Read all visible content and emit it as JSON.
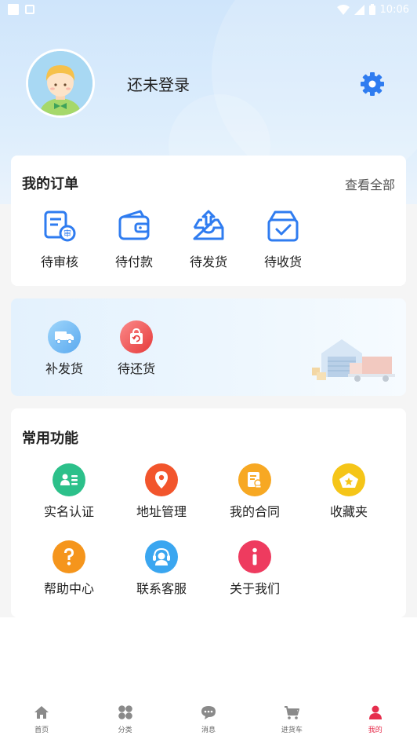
{
  "status_bar": {
    "time": "10:06"
  },
  "profile": {
    "login_text": "还未登录"
  },
  "orders": {
    "title": "我的订单",
    "view_all": "查看全部",
    "items": [
      {
        "label": "待审核",
        "icon": "pending-review-icon"
      },
      {
        "label": "待付款",
        "icon": "wallet-icon"
      },
      {
        "label": "待发货",
        "icon": "outbox-icon"
      },
      {
        "label": "待收货",
        "icon": "receive-box-icon"
      }
    ]
  },
  "promo": {
    "items": [
      {
        "label": "补发货",
        "icon": "truck-icon"
      },
      {
        "label": "待还货",
        "icon": "return-bag-icon"
      }
    ]
  },
  "features": {
    "title": "常用功能",
    "items": [
      {
        "label": "实名认证",
        "icon": "id-card-icon",
        "color": "#2cc08a"
      },
      {
        "label": "地址管理",
        "icon": "location-pin-icon",
        "color": "#f2552c"
      },
      {
        "label": "我的合同",
        "icon": "contract-icon",
        "color": "#f7a823"
      },
      {
        "label": "收藏夹",
        "icon": "star-icon",
        "color": "#f5c518"
      },
      {
        "label": "帮助中心",
        "icon": "question-icon",
        "color": "#f5951c"
      },
      {
        "label": "联系客服",
        "icon": "customer-service-icon",
        "color": "#3aa6f0"
      },
      {
        "label": "关于我们",
        "icon": "info-icon",
        "color": "#ee3b5f"
      }
    ]
  },
  "bottom_nav": [
    {
      "label": "首页",
      "icon": "home-icon"
    },
    {
      "label": "分类",
      "icon": "category-icon"
    },
    {
      "label": "消息",
      "icon": "message-icon"
    },
    {
      "label": "进货车",
      "icon": "cart-icon"
    },
    {
      "label": "我的",
      "icon": "user-icon",
      "active": true
    }
  ],
  "colors": {
    "accent_blue": "#2f7cf0",
    "active_nav": "#e62e4d"
  }
}
